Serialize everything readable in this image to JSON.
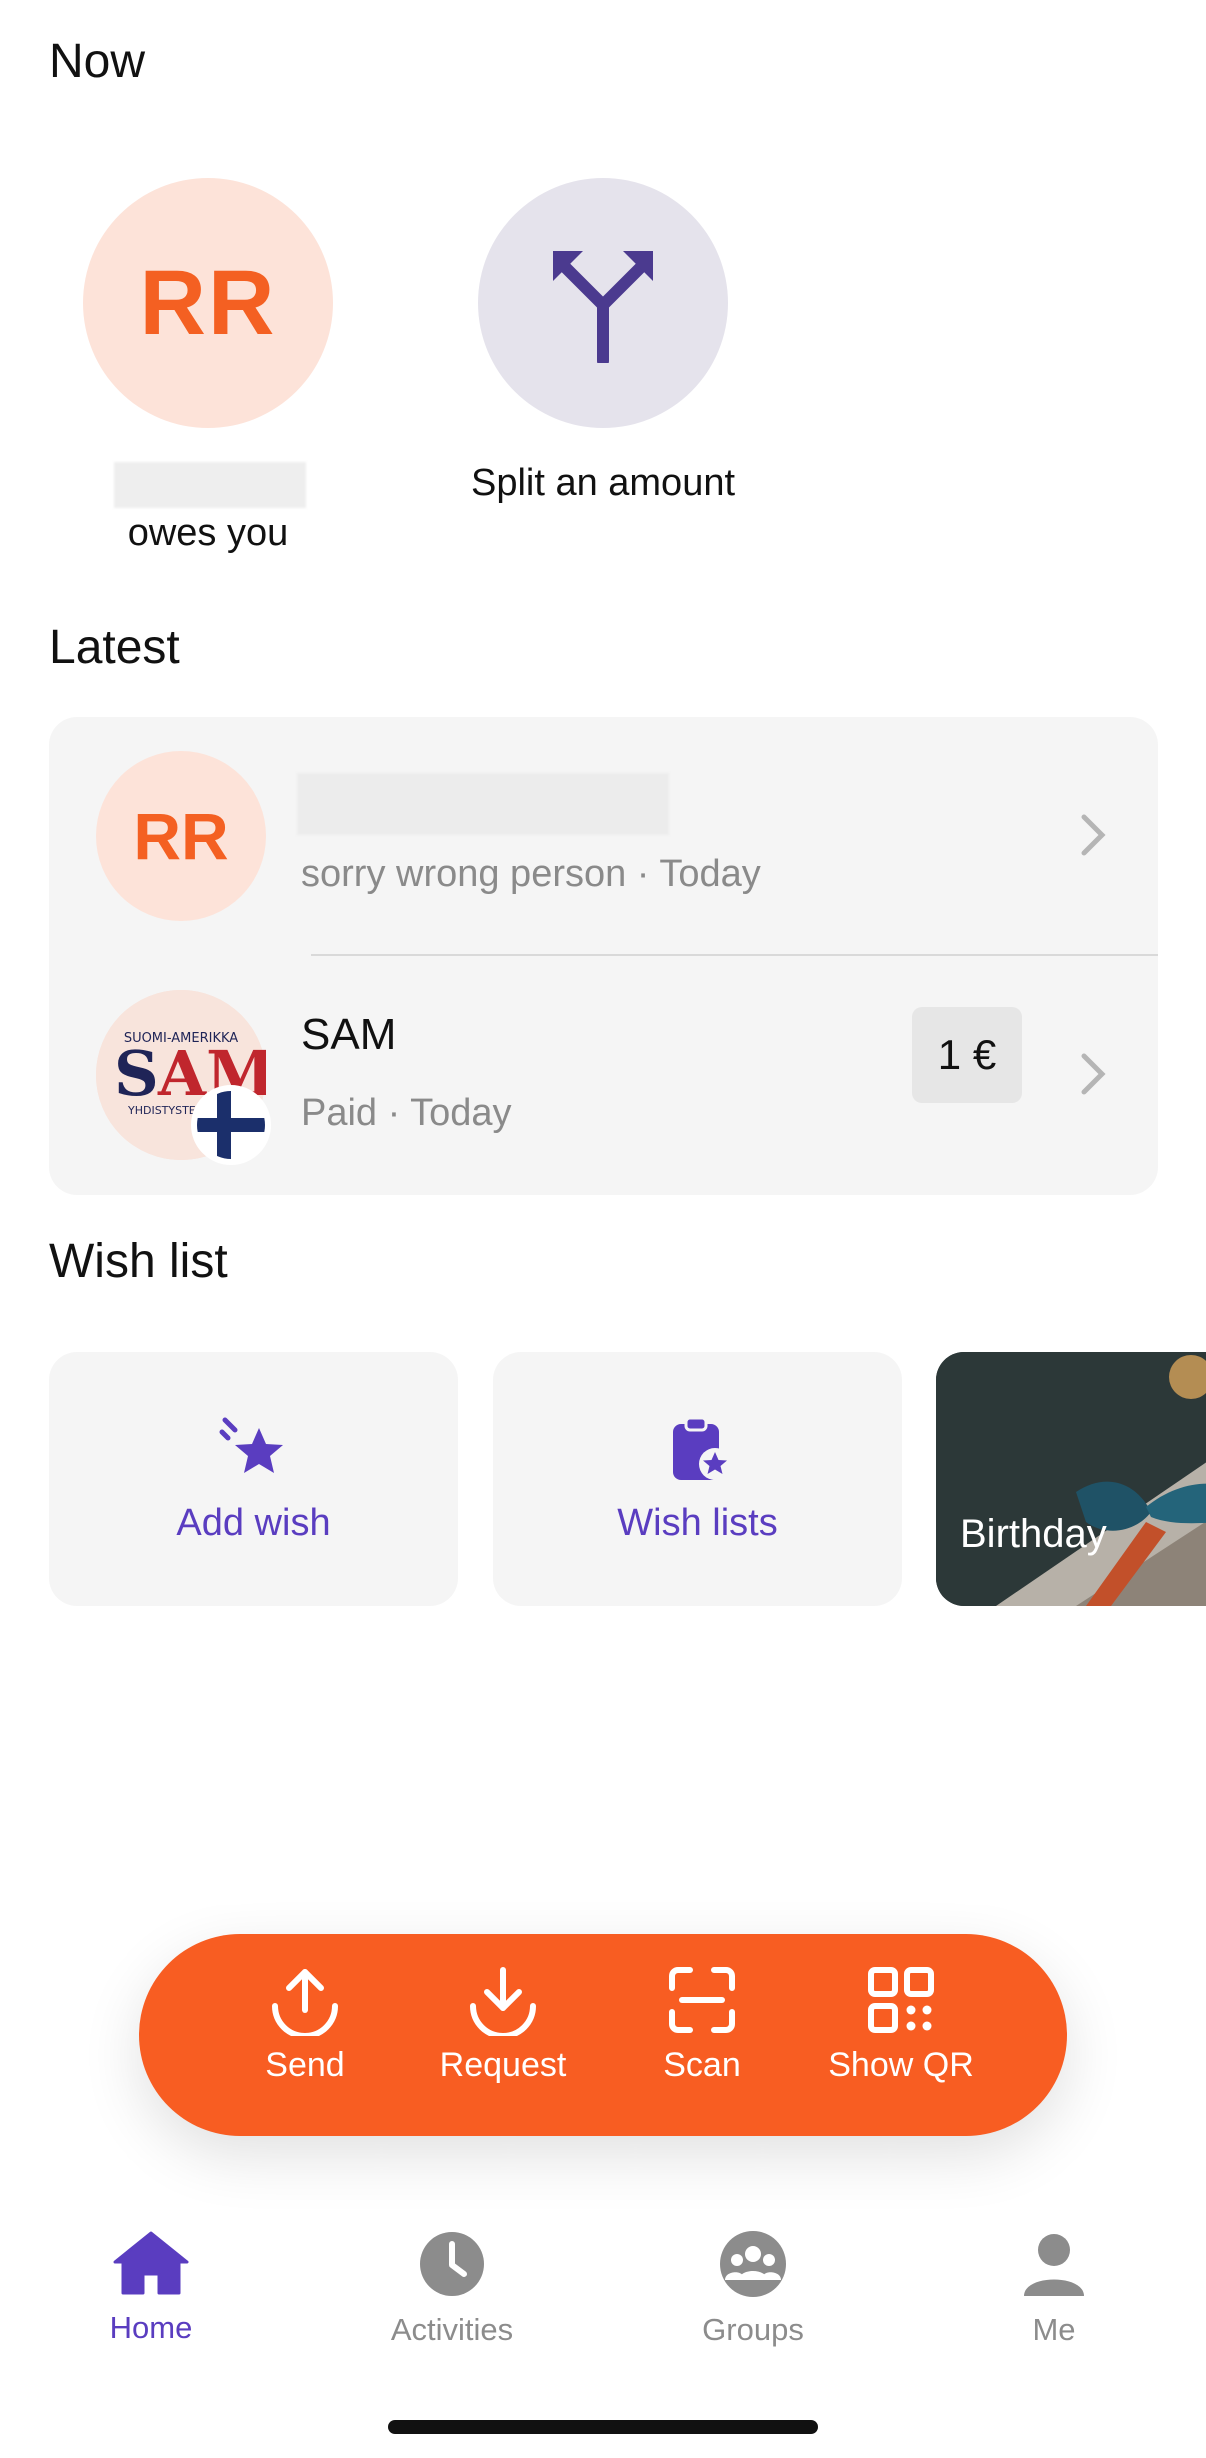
{
  "sections": {
    "now": "Now",
    "latest": "Latest",
    "wish_list": "Wish list"
  },
  "now": {
    "contact_initials": "RR",
    "contact_caption": "owes you",
    "split_label": "Split an amount"
  },
  "latest": [
    {
      "initials": "RR",
      "subtitle": "sorry wrong person · Today"
    },
    {
      "title": "SAM",
      "subtitle": "Paid · Today",
      "amount": "1 €"
    }
  ],
  "wish": {
    "add_label": "Add wish",
    "lists_label": "Wish lists",
    "birthday_label": "Birthday"
  },
  "actions": {
    "send": "Send",
    "request": "Request",
    "scan": "Scan",
    "show_qr": "Show QR"
  },
  "tabs": {
    "home": "Home",
    "activities": "Activities",
    "groups": "Groups",
    "me": "Me"
  },
  "colors": {
    "accent_orange": "#f85d22",
    "accent_purple": "#5a3dc0",
    "avatar_bg": "#fde3d9",
    "card_bg": "#f5f5f5"
  }
}
